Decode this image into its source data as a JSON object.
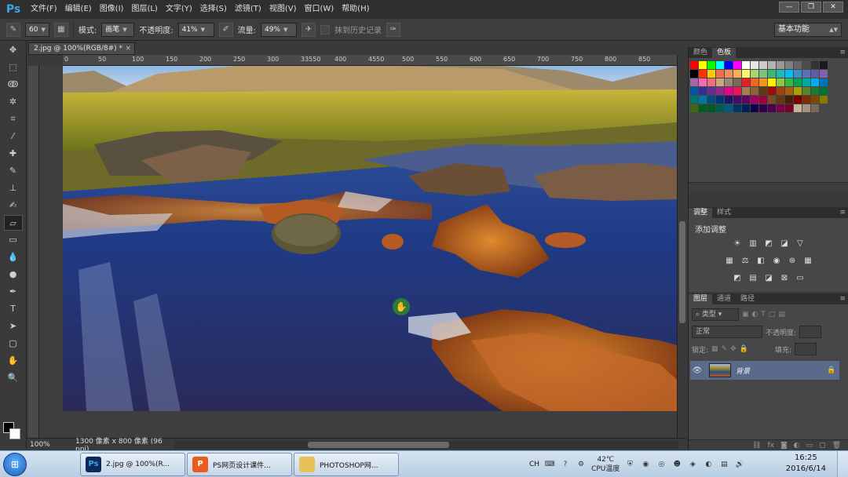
{
  "app": {
    "logo": "Ps"
  },
  "menubar": {
    "items": [
      "文件(F)",
      "编辑(E)",
      "图像(I)",
      "图层(L)",
      "文字(Y)",
      "选择(S)",
      "滤镜(T)",
      "视图(V)",
      "窗口(W)",
      "帮助(H)"
    ],
    "window_controls": [
      "minimize-icon",
      "restore-icon",
      "close-icon"
    ]
  },
  "options": {
    "brush_size": "60",
    "mode_label": "模式:",
    "mode_value": "画笔",
    "opacity_label": "不透明度:",
    "opacity_value": "41%",
    "flow_label": "流量:",
    "flow_value": "49%",
    "history_label": "抹到历史记录",
    "workspace": "基本功能"
  },
  "document": {
    "tab_title": "2.jpg @ 100%(RGB/8#) *",
    "close": "×",
    "zoom": "100%",
    "info": "1300 像素 x 800 像素 (96 ppi)"
  },
  "ruler": {
    "top_labels": [
      "0",
      "50",
      "100",
      "150",
      "200",
      "250",
      "300",
      "33550",
      "400",
      "4550",
      "500",
      "550",
      "600",
      "650",
      "700",
      "750",
      "800",
      "850"
    ]
  },
  "panels": {
    "swatch_tabs": [
      "颜色",
      "色板"
    ],
    "adjust_tabs": [
      "调整",
      "样式"
    ],
    "adjust_title": "添加调整",
    "layers_tabs": [
      "图层",
      "通道",
      "路径"
    ],
    "filter_kind": "类型",
    "blend_mode": "正常",
    "opacity_label": "不透明度:",
    "lock_label": "锁定:",
    "fill_label": "填充:",
    "layer_name": "背景"
  },
  "swatches": [
    "#ff0000",
    "#ffff00",
    "#00ff00",
    "#00ffff",
    "#0000ff",
    "#ff00ff",
    "#ffffff",
    "#e6e6e6",
    "#cccccc",
    "#b3b3b3",
    "#999999",
    "#808080",
    "#666666",
    "#4d4d4d",
    "#333333",
    "#1a1a1a",
    "#000000",
    "#ff3300",
    "#ffcc00",
    "#f26c4f",
    "#f68e55",
    "#fbaf5c",
    "#fff467",
    "#acd372",
    "#7cc576",
    "#3bb878",
    "#1abbb4",
    "#00bff3",
    "#438cca",
    "#5574b9",
    "#605ca8",
    "#855fa8",
    "#a763a8",
    "#f06ea9",
    "#f26d7d",
    "#c9a77b",
    "#998675",
    "#756b5b",
    "#ed1c24",
    "#f26522",
    "#f7941d",
    "#fff200",
    "#8dc63f",
    "#39b54a",
    "#00a651",
    "#00a99d",
    "#00aeef",
    "#0072bc",
    "#0054a6",
    "#2e3192",
    "#662d91",
    "#92278f",
    "#ec008c",
    "#ed145b",
    "#a67c52",
    "#8c6239",
    "#603913",
    "#9e0b0f",
    "#a0410d",
    "#a36209",
    "#aba000",
    "#598527",
    "#1a7b30",
    "#007236",
    "#00746b",
    "#0076a3",
    "#004b80",
    "#003471",
    "#1b1464",
    "#440e62",
    "#630460",
    "#9e005d",
    "#9e0039",
    "#754c24",
    "#603913",
    "#42210b",
    "#790000",
    "#7b2e00",
    "#7d4900",
    "#827b00",
    "#406618",
    "#005e20",
    "#005826",
    "#005952",
    "#005b7f",
    "#003663",
    "#002157",
    "#0d004c",
    "#32004b",
    "#4b0049",
    "#7b0046",
    "#7a0026",
    "#c7b299",
    "#a39382",
    "#796957"
  ],
  "taskbar": {
    "tasks": [
      {
        "icon": "Ps",
        "label": "2.jpg @ 100%(R..."
      },
      {
        "icon": "P",
        "label": "PS网页设计课件..."
      },
      {
        "icon": "",
        "label": "PHOTOSHOP网..."
      }
    ],
    "lang": "CH",
    "temp": "42℃",
    "cpu_label": "CPU温度",
    "time": "16:25",
    "date": "2016/6/14"
  }
}
